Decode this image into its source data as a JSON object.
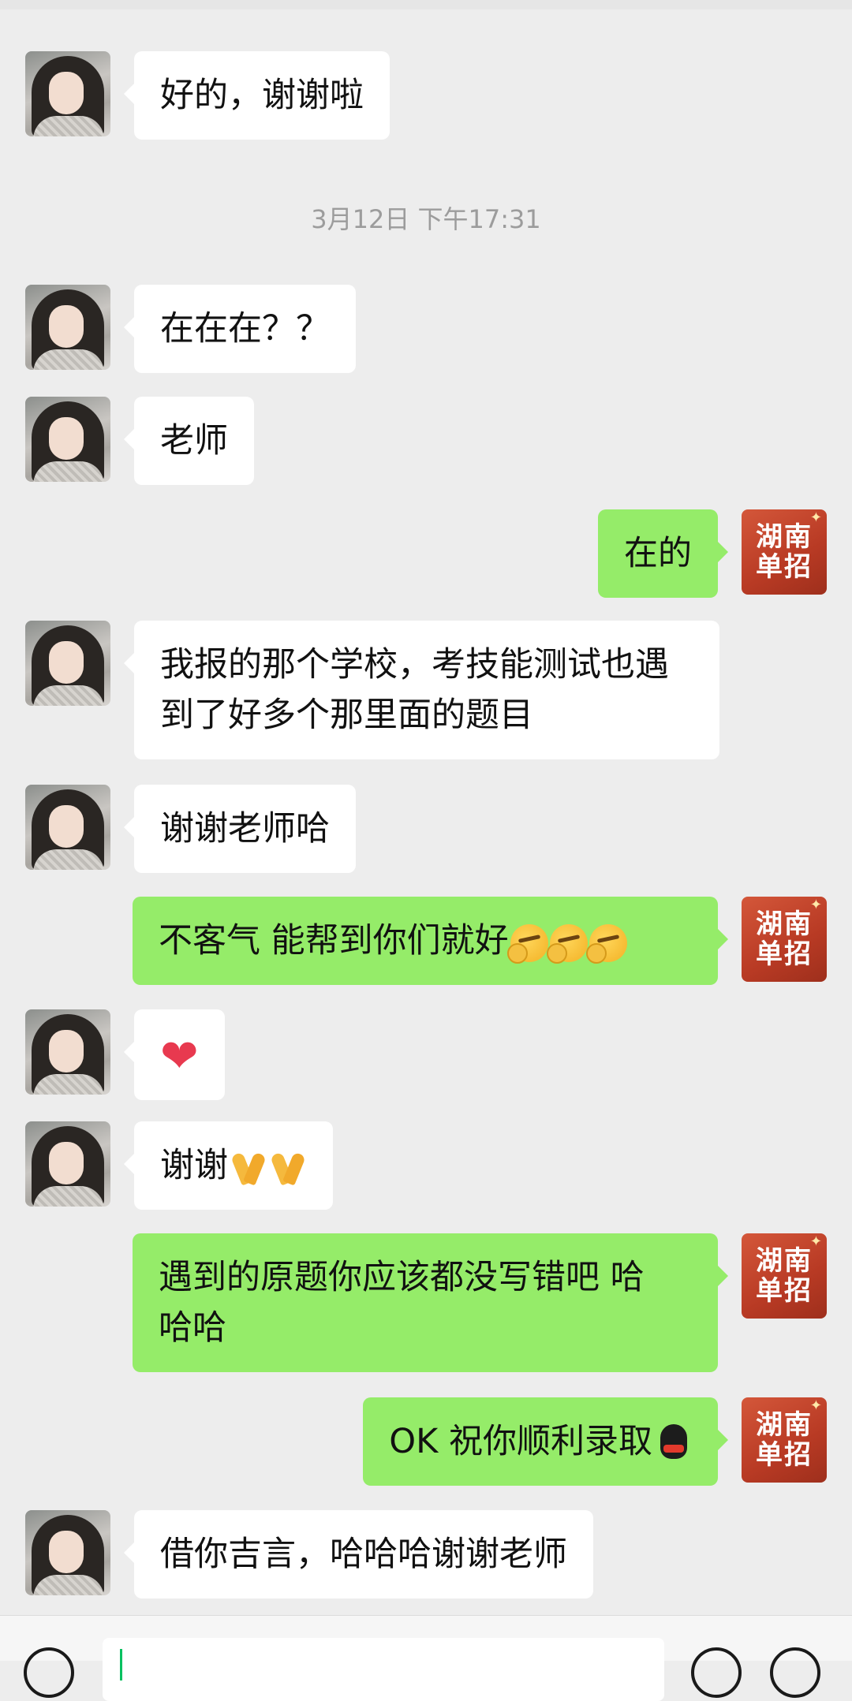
{
  "timestamp": "3月12日 下午17:31",
  "teacher_logo": {
    "line1": "湖南",
    "line2": "单招"
  },
  "messages": [
    {
      "from": "student",
      "text": "好的，谢谢啦"
    },
    {
      "from": "student",
      "text": "在在在？？"
    },
    {
      "from": "student",
      "text": "老师"
    },
    {
      "from": "teacher",
      "text": "在的"
    },
    {
      "from": "student",
      "line1": "我报的那个学校，考技能测试也遇",
      "line2": "到了好多个那里面的题目"
    },
    {
      "from": "student",
      "text": "谢谢老师哈"
    },
    {
      "from": "teacher",
      "text": "不客气 能帮到你们就好",
      "emoji": "smirk-icon x3"
    },
    {
      "from": "student",
      "emoji": "heart-icon"
    },
    {
      "from": "student",
      "text": "谢谢",
      "emoji": "pray-icon x2"
    },
    {
      "from": "teacher",
      "line1": "遇到的原题你应该都没写错吧 哈",
      "line2": "哈哈"
    },
    {
      "from": "teacher",
      "text": "OK 祝你顺利录取",
      "emoji": "penguin-icon"
    },
    {
      "from": "student",
      "text": "借你吉言，哈哈哈谢谢老师"
    }
  ],
  "input": {
    "placeholder": ""
  }
}
